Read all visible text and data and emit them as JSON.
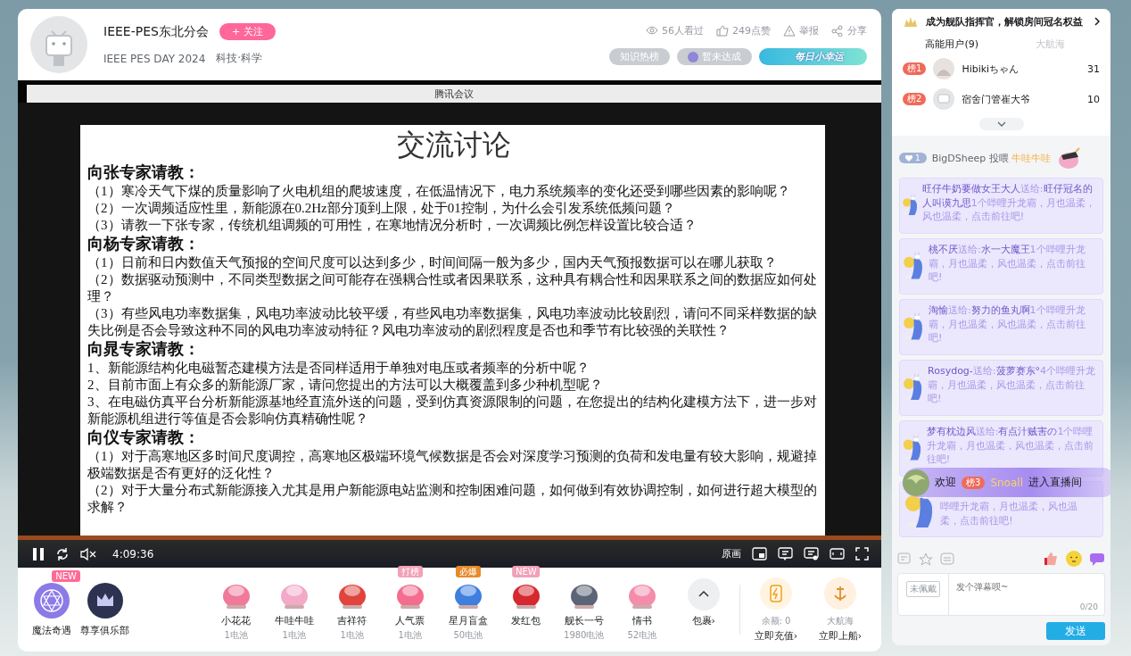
{
  "streamer": {
    "name": "IEEE-PES东北分会",
    "follow": "+ 关注",
    "title": "IEEE PES DAY 2024",
    "category": "科技·科学"
  },
  "stats": [
    {
      "kind": "viewers",
      "text": "56人看过"
    },
    {
      "kind": "likes",
      "text": "249点赞"
    },
    {
      "kind": "report",
      "text": "举报"
    },
    {
      "kind": "share",
      "text": "分享"
    }
  ],
  "header_badges": [
    {
      "kind": "pill",
      "text": "知识热榜"
    },
    {
      "kind": "goal",
      "text": "暂未达成"
    },
    {
      "kind": "banner",
      "text": "每日小幸运"
    }
  ],
  "video": {
    "window_title": "腾讯会议",
    "slide": {
      "title": "交流讨论",
      "sections": [
        {
          "heading": "向张专家请教：",
          "items": [
            "（1）寒冷天气下煤的质量影响了火电机组的爬坡速度，在低温情况下，电力系统频率的变化还受到哪些因素的影响呢？",
            "（2）一次调频适应性里，新能源在0.2Hz部分顶到上限，处于01控制，为什么会引发系统低频问题？",
            "（3）请教一下张专家，传统机组调频的可用性，在寒地情况分析时，一次调频比例怎样设置比较合适？"
          ]
        },
        {
          "heading": "向杨专家请教：",
          "items": [
            "（1）日前和日内数值天气预报的空间尺度可以达到多少，时间间隔一般为多少，国内天气预报数据可以在哪儿获取？",
            "（2）数据驱动预测中，不同类型数据之间可能存在强耦合性或者因果联系，这种具有耦合性和因果联系之间的数据应如何处理？",
            "（3）有些风电功率数据集，风电功率波动比较平缓，有些风电功率数据集，风电功率波动比较剧烈，请问不同采样数据的缺失比例是否会导致这种不同的风电功率波动特征？风电功率波动的剧烈程度是否也和季节有比较强的关联性？"
          ]
        },
        {
          "heading": "向晁专家请教：",
          "items": [
            "1、新能源结构化电磁暂态建模方法是否同样适用于单独对电压或者频率的分析中呢？",
            "2、目前市面上有众多的新能源厂家，请问您提出的方法可以大概覆盖到多少种机型呢？",
            "3、在电磁仿真平台分析新能源基地经直流外送的问题，受到仿真资源限制的问题，在您提出的结构化建模方法下，进一步对新能源机组进行等值是否会影响仿真精确性呢？"
          ]
        },
        {
          "heading": "向仪专家请教：",
          "items": [
            "（1）对于高寒地区多时间尺度调控，高寒地区极端环境气候数据是否会对深度学习预测的负荷和发电量有较大影响，规避掉极端数据是否有更好的泛化性？",
            "（2）对于大量分布式新能源接入尤其是用户新能源电站监测和控制困难问题，如何做到有效协调控制，如何进行超大模型的求解？"
          ]
        }
      ]
    },
    "controls": {
      "playing": true,
      "muted": true,
      "time": "4:09:36",
      "quality": "原画"
    }
  },
  "gift_bar": {
    "left": [
      {
        "label": "魔法奇遇",
        "badge": "NEW"
      },
      {
        "label": "尊享俱乐部"
      }
    ],
    "gifts": [
      {
        "name": "小花花",
        "price": "1电池"
      },
      {
        "name": "牛哇牛哇",
        "price": "1电池"
      },
      {
        "name": "吉祥符",
        "price": "1电池"
      },
      {
        "name": "人气票",
        "price": "1电池",
        "badge": "打榜"
      },
      {
        "name": "星月盲盒",
        "price": "50电池",
        "badge": "必爆"
      },
      {
        "name": "发红包",
        "badge": "NEW"
      },
      {
        "name": "舰长一号",
        "price": "1980电池"
      },
      {
        "name": "情书",
        "price": "52电池"
      }
    ],
    "bag": "包裹›",
    "balance": {
      "label": "余额: 0",
      "action": "立即充值›"
    },
    "fleet": {
      "label": "大航海",
      "action": "立即上船›"
    }
  },
  "side": {
    "promo": "成为舰队指挥官，解锁房间冠名权益",
    "tabs": [
      {
        "label": "高能用户(9)",
        "selected": true
      },
      {
        "label": "大航海",
        "selected": false
      }
    ],
    "ranking": [
      {
        "rank": "榜1",
        "name": "Hibikiちゃん",
        "score": "31"
      },
      {
        "rank": "榜2",
        "name": "宿舍门管崔大爷",
        "score": "10"
      }
    ],
    "chat": [
      {
        "kind": "gift_feed",
        "medal": "1",
        "user": "BigDSheep",
        "action": "投喂",
        "gift": "牛哇牛哇"
      },
      {
        "kind": "gift_notice",
        "sender": "旺仔牛奶要做女王大人",
        "verb": "送给:",
        "receiver": "旺仔冠名的人叫谟九思",
        "message": "1个哔哩升龙霸，月也温柔，风也温柔，点击前往吧!"
      },
      {
        "kind": "gift_notice",
        "sender": "桃不厌",
        "verb": "送给:",
        "receiver": "水一大魔王",
        "message": "1个哔哩升龙霸，月也温柔，风也温柔，点击前往吧!"
      },
      {
        "kind": "gift_notice",
        "sender": "淘愉",
        "verb": "送给:",
        "receiver": "努力的鱼丸啊",
        "message": "1个哔哩升龙霸，月也温柔，风也温柔，点击前往吧!"
      },
      {
        "kind": "gift_notice",
        "sender": "Rosydog-",
        "verb": "送给:",
        "receiver": "菠萝赛东°",
        "message": "4个哔哩升龙霸，月也温柔，风也温柔，点击前往吧!"
      },
      {
        "kind": "gift_notice",
        "sender": "梦有枕边风",
        "verb": "送给:",
        "receiver": "有点汁贼害の",
        "message": "1个哔哩升龙霸，月也温柔，风也温柔，点击前往吧!"
      },
      {
        "kind": "partial",
        "message": "哔哩升龙霸，月也温柔，风也温柔，点击前往吧!"
      }
    ],
    "welcome": {
      "prefix": "欢迎",
      "rank": "榜3",
      "name": "Snoall",
      "suffix": "进入直播间"
    },
    "medal": "未佩戴",
    "input": {
      "placeholder": "发个弹幕呗~",
      "count": "0/20"
    },
    "send": "发送"
  }
}
